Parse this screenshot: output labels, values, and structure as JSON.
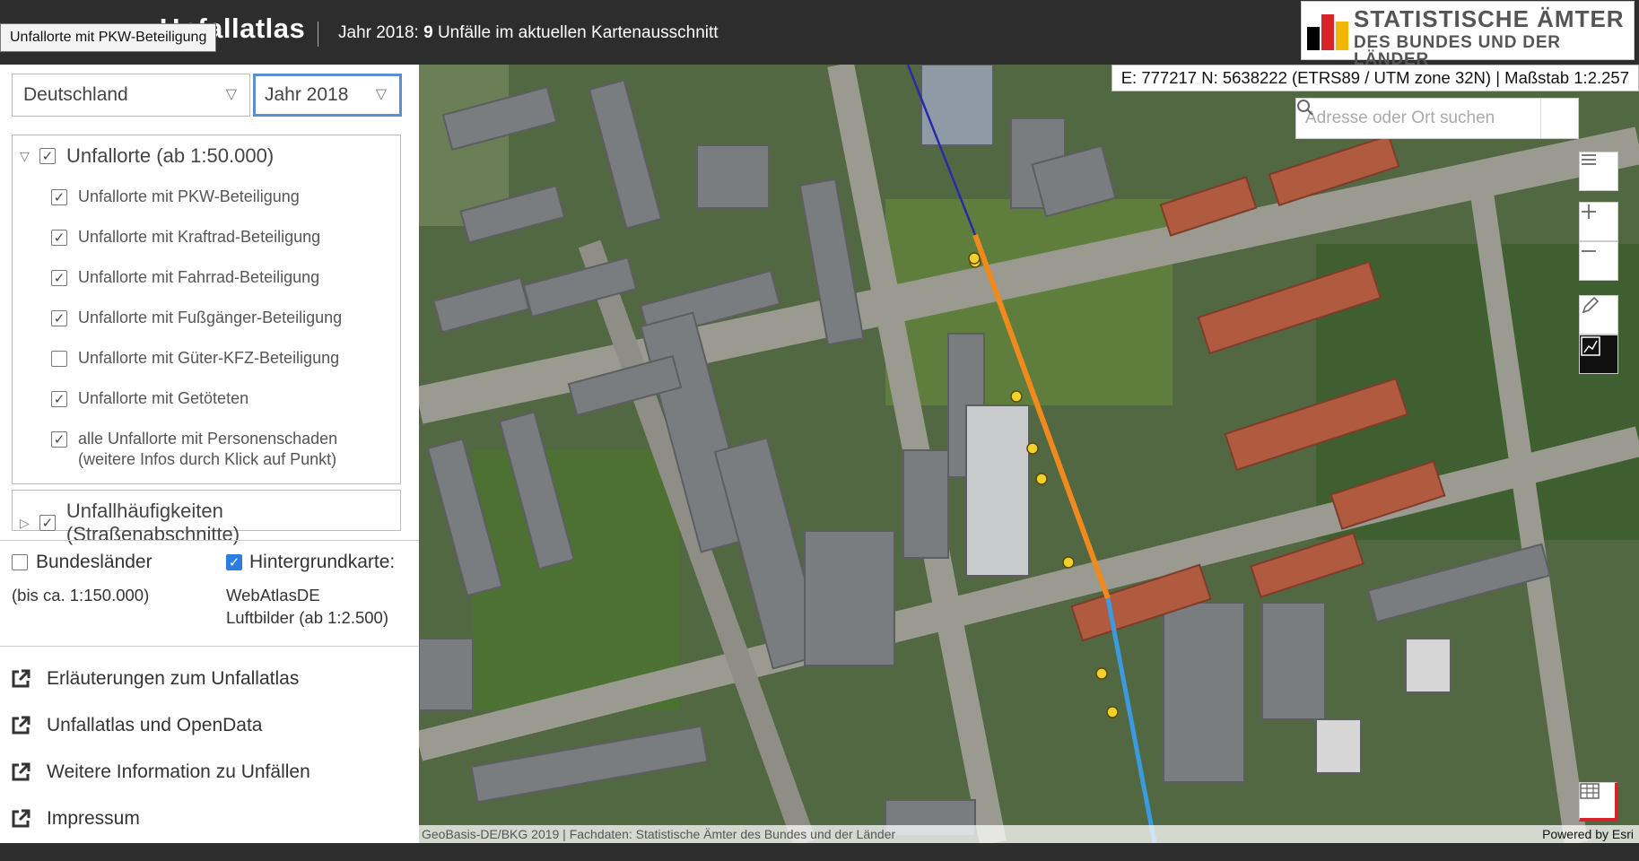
{
  "header": {
    "app_title": "Unfallatlas",
    "year_prefix": "Jahr 2018:",
    "accident_count": "9",
    "accident_suffix": "Unfälle im aktuellen Kartenausschnitt",
    "tooltip": "Unfallorte mit PKW-Beteiligung",
    "logo_line1": "STATISTISCHE ÄMTER",
    "logo_line2": "DES BUNDES UND DER LÄNDER",
    "logo_colors": [
      "#000000",
      "#d8232a",
      "#f2b705"
    ]
  },
  "filters": {
    "region": "Deutschland",
    "year": "Jahr 2018"
  },
  "layers": {
    "group1_label": "Unfallorte (ab 1:50.000)",
    "items": [
      {
        "label": "Unfallorte mit PKW-Beteiligung",
        "checked": true
      },
      {
        "label": "Unfallorte mit Kraftrad-Beteiligung",
        "checked": true
      },
      {
        "label": "Unfallorte mit Fahrrad-Beteiligung",
        "checked": true
      },
      {
        "label": "Unfallorte mit Fußgänger-Beteiligung",
        "checked": true
      },
      {
        "label": "Unfallorte mit Güter-KFZ-Beteiligung",
        "checked": false
      },
      {
        "label": "Unfallorte mit Getöteten",
        "checked": true
      },
      {
        "label": "alle Unfallorte mit Personenschaden",
        "sublabel": "(weitere Infos durch Klick auf Punkt)",
        "checked": true
      }
    ],
    "group2_label": "Unfallhäufigkeiten (Straßenabschnitte)"
  },
  "options": {
    "states_label": "Bundesländer",
    "states_sub": "(bis ca. 1:150.000)",
    "basemap_label": "Hintergrundkarte:",
    "basemap_line1": "WebAtlasDE",
    "basemap_line2": "Luftbilder (ab 1:2.500)"
  },
  "links": [
    "Erläuterungen zum Unfallatlas",
    "Unfallatlas und OpenData",
    "Weitere Information zu Unfällen",
    "Impressum"
  ],
  "map": {
    "coords": "E: 777217 N: 5638222 (ETRS89 / UTM zone 32N) | Maßstab 1:2.257",
    "search_placeholder": "Adresse oder Ort suchen",
    "attribution": "GeoBasis-DE/BKG 2019 | Fachdaten: Statistische Ämter des Bundes und der Länder",
    "powered_by": "Powered by Esri",
    "accident_marker_color": "#f2d22a",
    "segment_colors": {
      "high": "#f08a1c",
      "low": "#3a9be0",
      "north": "#2a2aa8"
    }
  }
}
